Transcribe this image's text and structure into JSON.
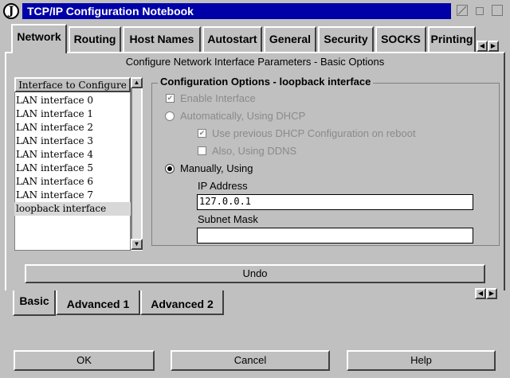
{
  "window": {
    "icon_glyph": "J",
    "title": "TCP/IP Configuration Notebook"
  },
  "tabs": [
    "Network",
    "Routing",
    "Host Names",
    "Autostart",
    "General",
    "Security",
    "SOCKS",
    "Printing"
  ],
  "page_header": "Configure Network Interface Parameters - Basic Options",
  "interfaces": {
    "header": "Interface to Configure",
    "items": [
      "LAN interface 0",
      "LAN interface 1",
      "LAN interface 2",
      "LAN interface 3",
      "LAN interface 4",
      "LAN interface 5",
      "LAN interface 6",
      "LAN interface 7",
      "loopback interface"
    ],
    "selected": "loopback interface"
  },
  "options": {
    "title": "Configuration Options - loopback interface",
    "enable_interface": "Enable Interface",
    "auto_dhcp": "Automatically, Using DHCP",
    "use_previous_dhcp": "Use previous DHCP Configuration on reboot",
    "also_ddns": "Also, Using DDNS",
    "manually": "Manually, Using",
    "ip_label": "IP Address",
    "ip_value": "127.0.0.1",
    "mask_label": "Subnet Mask",
    "mask_value": ""
  },
  "undo_label": "Undo",
  "bottom_tabs": [
    "Basic",
    "Advanced 1",
    "Advanced 2"
  ],
  "buttons": {
    "ok": "OK",
    "cancel": "Cancel",
    "help": "Help"
  }
}
